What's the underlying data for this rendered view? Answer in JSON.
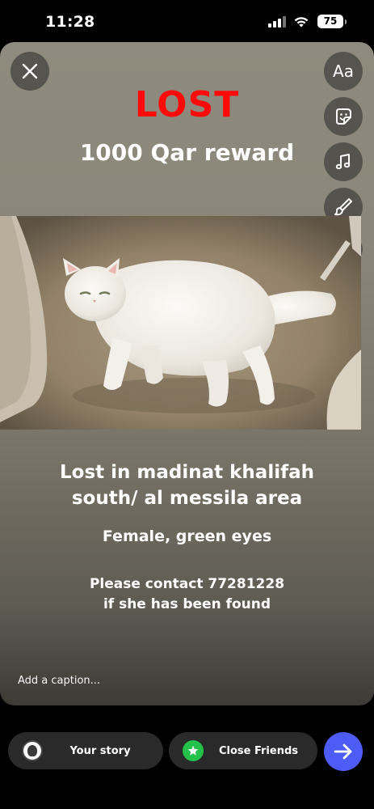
{
  "status_bar": {
    "time": "11:28",
    "battery": "75",
    "icons": [
      "signal-icon",
      "wifi-icon",
      "battery-icon"
    ]
  },
  "story": {
    "title": "LOST",
    "title_color": "#ff0a0a",
    "reward": "1000 Qar reward",
    "location_line1": "Lost in madinat khalifah",
    "location_line2": "south/ al messila area",
    "details": "Female, green eyes",
    "contact_line1": "Please contact 77281228",
    "contact_line2": "if she has been found",
    "caption_placeholder": "Add a caption..."
  },
  "tools": {
    "text": "Aa",
    "items": [
      "text-tool-icon",
      "sticker-icon",
      "music-icon",
      "draw-icon",
      "chevron-down-icon"
    ]
  },
  "bottom_bar": {
    "your_story": "Your story",
    "close_friends": "Close Friends",
    "send_color": "#4d5cf5",
    "close_friends_color": "#25c24b"
  }
}
